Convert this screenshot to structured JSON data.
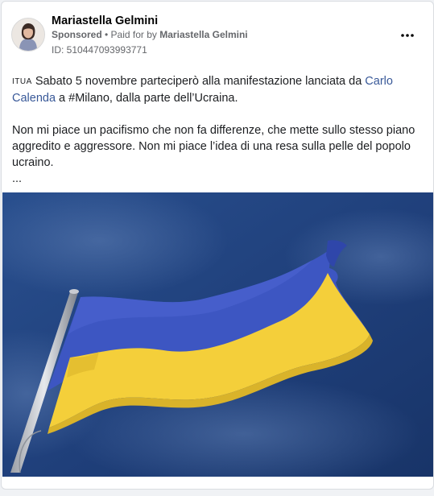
{
  "post": {
    "author": "Mariastella Gelmini",
    "sponsored_label": "Sponsored",
    "paid_for_prefix": "• Paid for by",
    "paid_for_name": "Mariastella Gelmini",
    "ad_id": "ID: 510447093993771",
    "more_icon": "more-horizontal-icon",
    "text": {
      "lang_tag": "ITUA",
      "line1_before_link": "Sabato 5 novembre parteciperò alla manifestazione lanciata da",
      "link": "Carlo Calenda",
      "line1_after_link": "a #Milano, dalla parte dell’Ucraina.",
      "paragraph2": "Non mi piace un pacifismo che non fa differenze, che mette sullo stesso piano aggredito e aggressore. Non mi piace l’idea di una resa sulla pelle del popolo ucraino.",
      "ellipsis": "..."
    }
  },
  "colors": {
    "link": "#385898",
    "secondary_text": "#65676b",
    "flag_blue": "#3d56c2",
    "flag_yellow": "#f4cf3a",
    "sky": "#1f3f7a"
  }
}
